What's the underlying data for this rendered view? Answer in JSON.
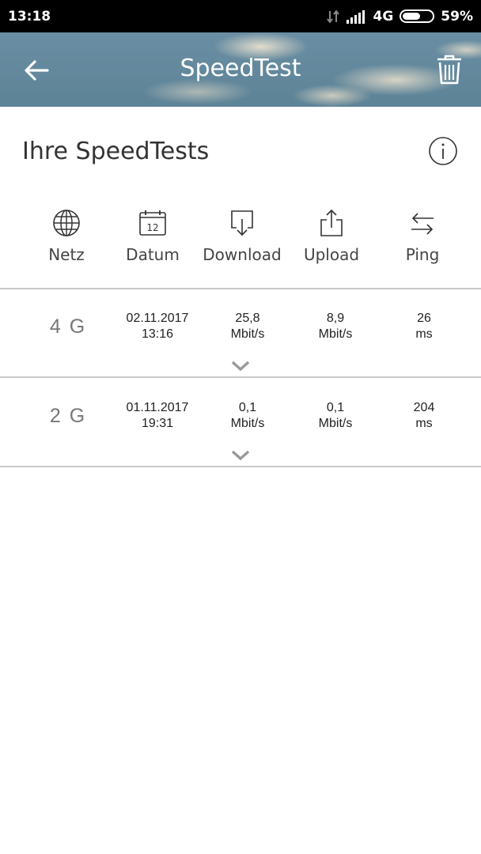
{
  "status_bar": {
    "time": "13:18",
    "network": "4G",
    "battery": "59%",
    "battery_level": 0.59
  },
  "app_bar": {
    "title": "SpeedTest",
    "back_icon": "arrow-left-icon",
    "delete_icon": "trash-icon"
  },
  "section": {
    "title": "Ihre SpeedTests",
    "info_icon": "info-icon"
  },
  "columns": [
    {
      "label": "Netz",
      "icon": "globe-icon"
    },
    {
      "label": "Datum",
      "icon": "calendar-icon",
      "icon_text": "12"
    },
    {
      "label": "Download",
      "icon": "download-icon"
    },
    {
      "label": "Upload",
      "icon": "upload-icon"
    },
    {
      "label": "Ping",
      "icon": "swap-arrows-icon"
    }
  ],
  "results": [
    {
      "network": "4 G",
      "date": "02.11.2017",
      "time": "13:16",
      "download": "25,8",
      "download_unit": "Mbit/s",
      "upload": "8,9",
      "upload_unit": "Mbit/s",
      "ping": "26",
      "ping_unit": "ms"
    },
    {
      "network": "2 G",
      "date": "01.11.2017",
      "time": "19:31",
      "download": "0,1",
      "download_unit": "Mbit/s",
      "upload": "0,1",
      "upload_unit": "Mbit/s",
      "ping": "204",
      "ping_unit": "ms"
    }
  ]
}
